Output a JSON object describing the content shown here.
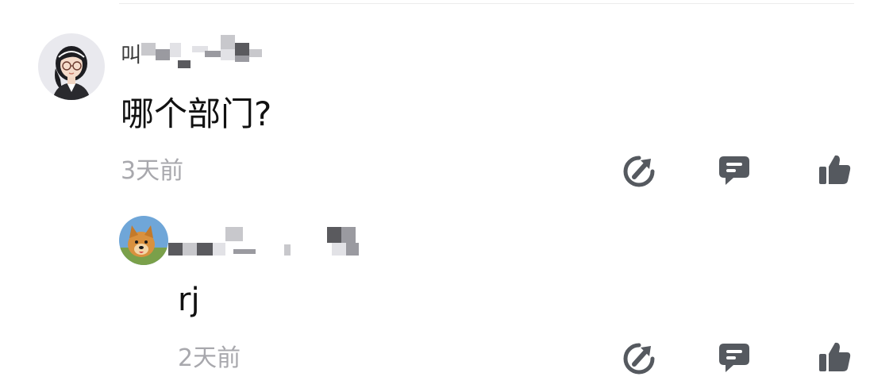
{
  "comments": [
    {
      "username_visible": "叫",
      "content": "哪个部门?",
      "time": "3天前",
      "actions": [
        {
          "icon": "share-icon",
          "label": "share"
        },
        {
          "icon": "comment-icon",
          "label": "reply"
        },
        {
          "icon": "thumbs-up-icon",
          "label": "like"
        }
      ]
    },
    {
      "username_visible": "",
      "content": "rj",
      "time": "2天前",
      "actions": [
        {
          "icon": "share-icon",
          "label": "share"
        },
        {
          "icon": "comment-icon",
          "label": "reply"
        },
        {
          "icon": "thumbs-up-icon",
          "label": "like"
        }
      ]
    }
  ],
  "colors": {
    "icon": "#55595f",
    "time": "#a8a8ad",
    "content": "#111111",
    "divider": "#ececec",
    "pixelation": [
      "#5a5a5e",
      "#9a9aa0",
      "#c8c8cc",
      "#e2e2e6"
    ]
  }
}
